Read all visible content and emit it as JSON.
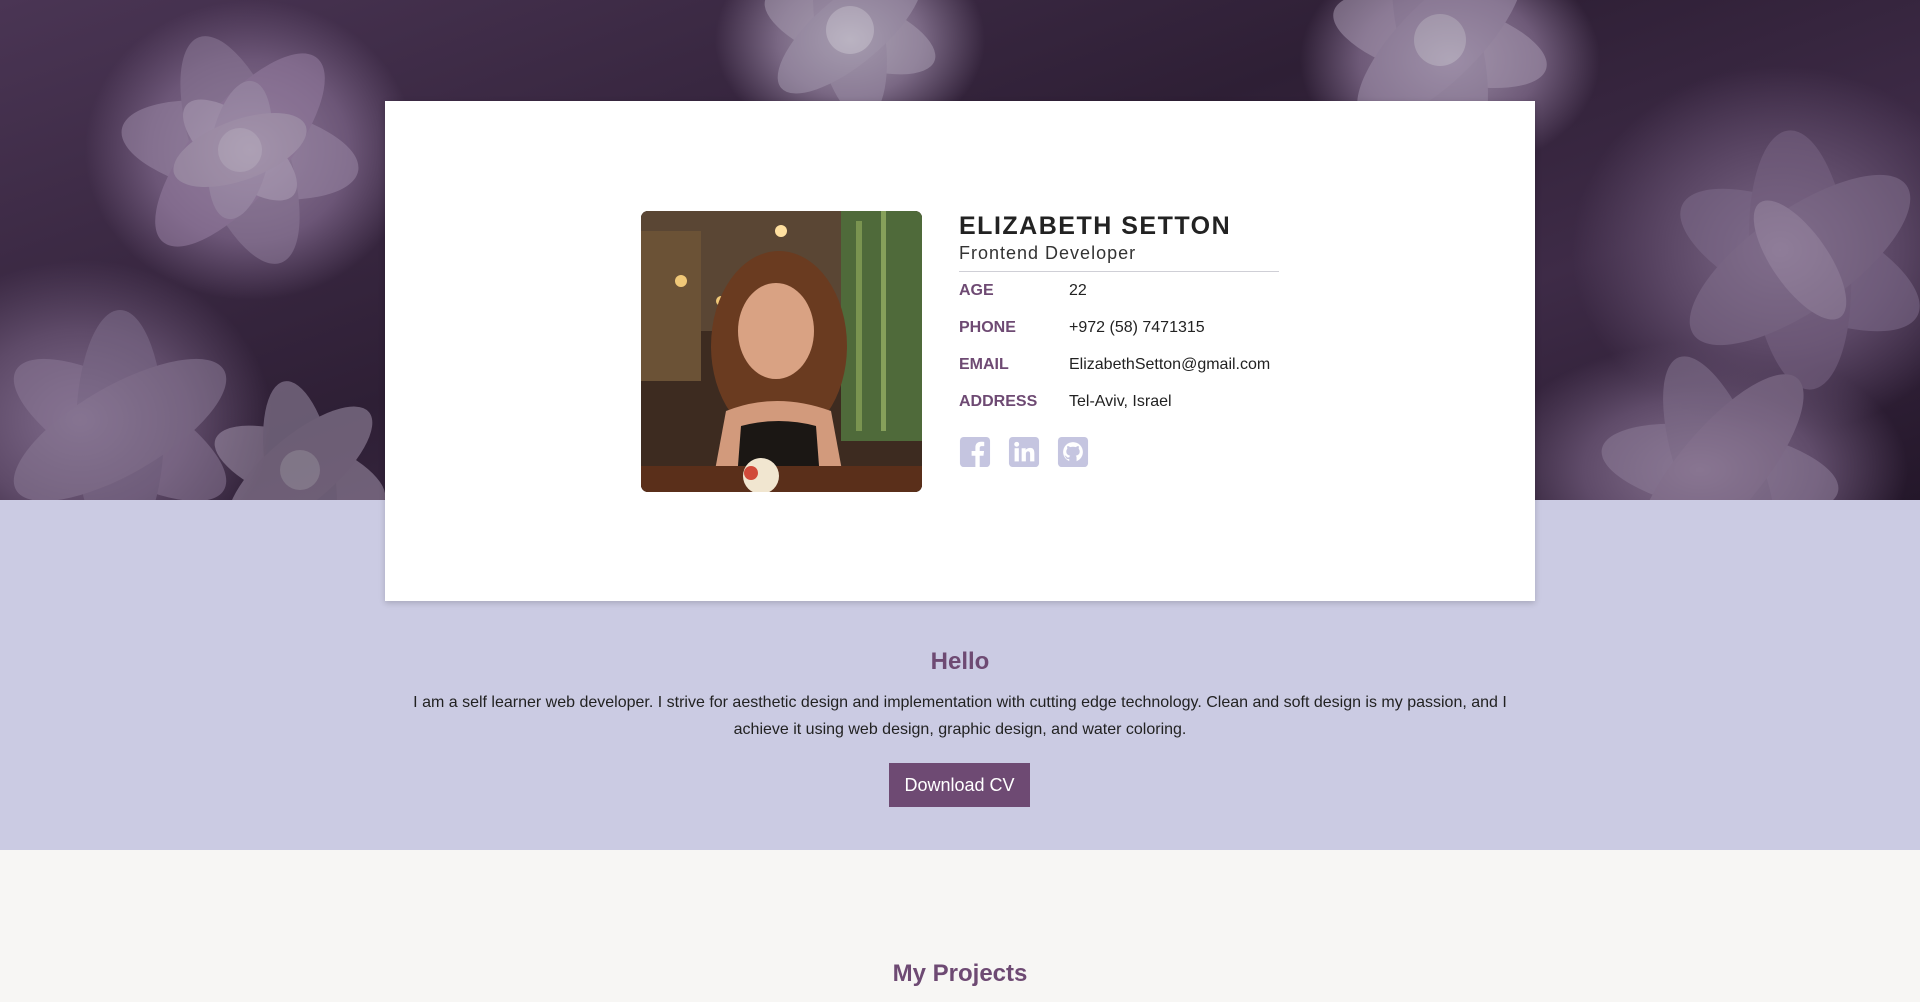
{
  "profile": {
    "name": "ELIZABETH SETTON",
    "role": "Frontend Developer",
    "details": [
      {
        "label": "AGE",
        "value": "22"
      },
      {
        "label": "PHONE",
        "value": "+972 (58) 7471315"
      },
      {
        "label": "EMAIL",
        "value": "ElizabethSetton@gmail.com"
      },
      {
        "label": "ADDRESS",
        "value": "Tel-Aviv, Israel"
      }
    ],
    "social_icons": [
      "facebook-icon",
      "linkedin-icon",
      "github-icon"
    ]
  },
  "about": {
    "title": "Hello",
    "text": "I am a self learner web developer. I strive for aesthetic design and implementation with cutting edge technology. Clean and soft design is my passion, and I achieve it using web design, graphic design, and water coloring.",
    "download_label": "Download CV"
  },
  "projects": {
    "title": "My Projects"
  },
  "colors": {
    "accent": "#6e4a73",
    "band": "#cbcbe3",
    "page": "#f7f6f4",
    "icon": "#c5c5e0"
  }
}
